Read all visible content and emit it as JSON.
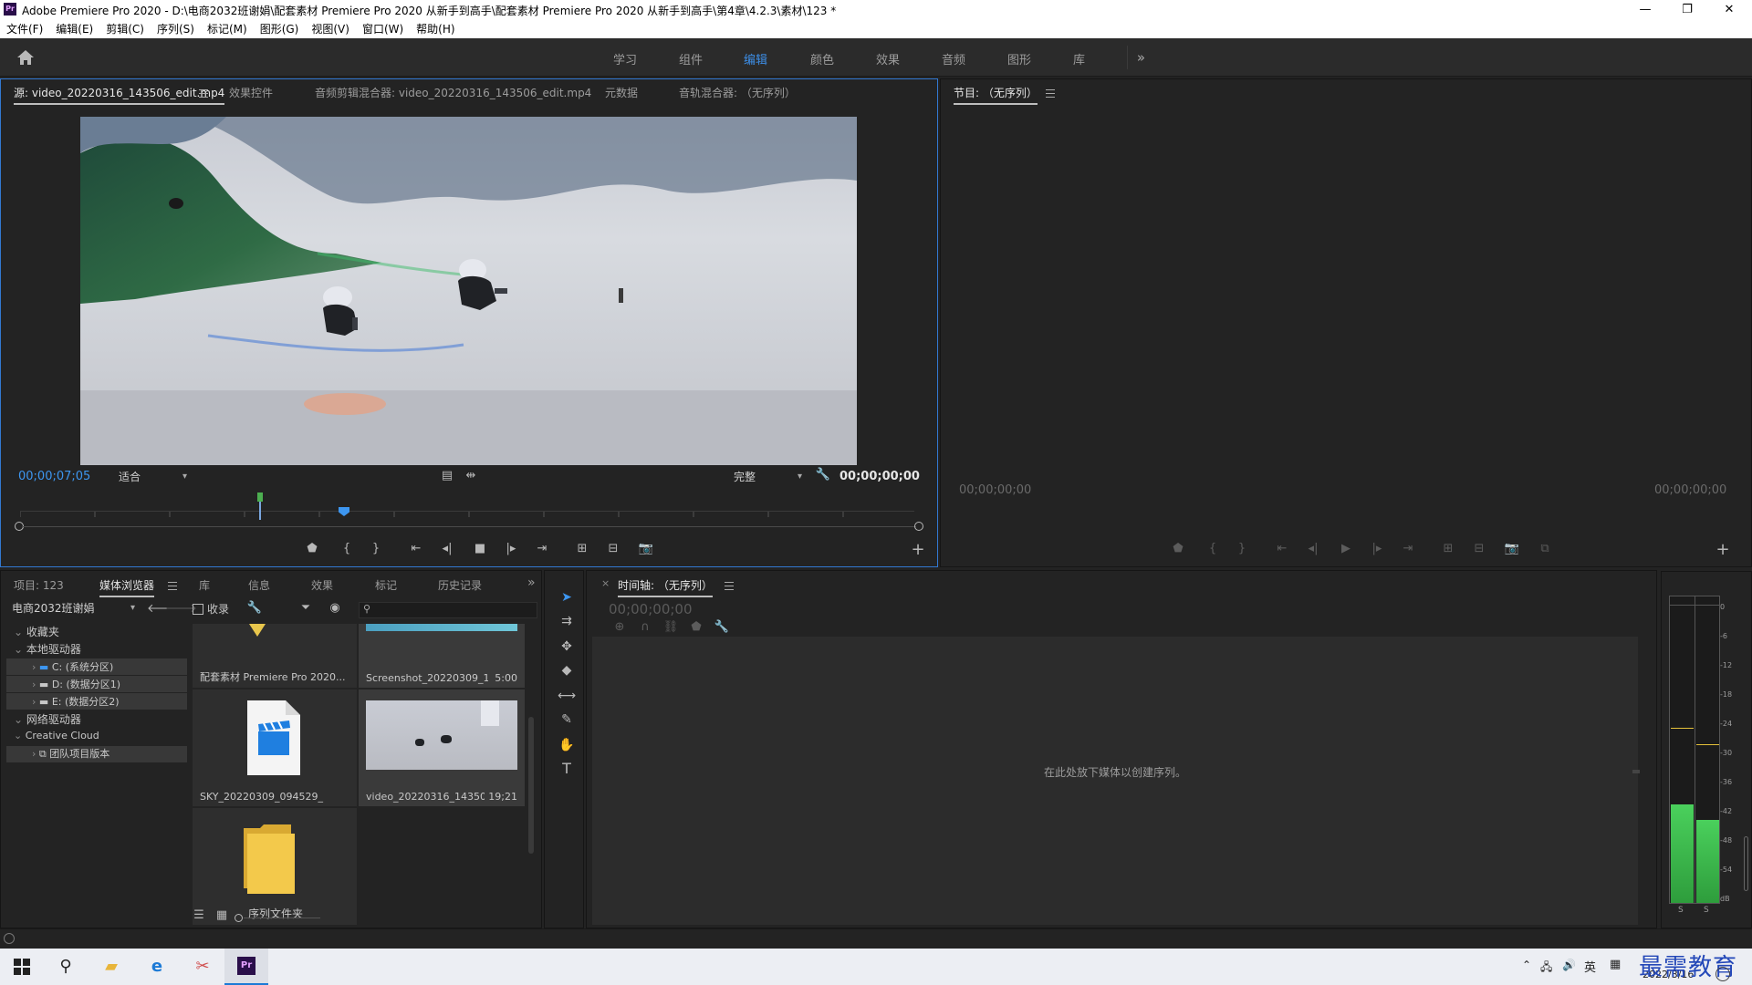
{
  "window": {
    "app_icon_text": "Pr",
    "title": "Adobe Premiere Pro 2020 - D:\\电商2032班谢娟\\配套素材 Premiere Pro 2020 从新手到高手\\配套素材 Premiere Pro 2020 从新手到高手\\第4章\\4.2.3\\素材\\123 *",
    "minimize": "—",
    "restore": "❐",
    "close": "✕"
  },
  "menu": [
    "文件(F)",
    "编辑(E)",
    "剪辑(C)",
    "序列(S)",
    "标记(M)",
    "图形(G)",
    "视图(V)",
    "窗口(W)",
    "帮助(H)"
  ],
  "workspaces": {
    "items": [
      "学习",
      "组件",
      "编辑",
      "颜色",
      "效果",
      "音频",
      "图形",
      "库"
    ],
    "active": "编辑",
    "overflow": "»"
  },
  "source_panel": {
    "tabs": [
      "源: video_20220316_143506_edit.mp4",
      "效果控件",
      "音频剪辑混合器: video_20220316_143506_edit.mp4",
      "元数据",
      "音轨混合器: （无序列）"
    ],
    "playhead_timecode": "00;00;07;05",
    "zoom": "适合",
    "quality": "完整",
    "duration_timecode": "00;00;00;00",
    "plus": "+"
  },
  "program_panel": {
    "title": "节目: （无序列）",
    "timecode_left": "00;00;00;00",
    "timecode_right": "00;00;00;00",
    "plus": "+"
  },
  "project_panel": {
    "tabs": [
      "项目: 123",
      "媒体浏览器",
      "库",
      "信息",
      "效果",
      "标记",
      "历史记录"
    ],
    "active_tab": "媒体浏览器",
    "overflow": "»",
    "location": "电商2032班谢娟",
    "ingest_label": "收录",
    "search_placeholder": "",
    "tree": {
      "favorites": "收藏夹",
      "local_drives": "本地驱动器",
      "drive_c": "C: (系统分区)",
      "drive_d": "D: (数据分区1)",
      "drive_e": "E: (数据分区2)",
      "network_drives": "网络驱动器",
      "creative_cloud": "Creative Cloud",
      "team_projects": "团队项目版本"
    },
    "items": [
      {
        "label": "配套素材 Premiere Pro 2020...",
        "duration": ""
      },
      {
        "label": "Screenshot_20220309_14...",
        "duration": "5:00"
      },
      {
        "label": "SKY_20220309_094529_",
        "duration": ""
      },
      {
        "label": "video_20220316_14350...",
        "duration": "19;21"
      },
      {
        "label": "序列文件夹",
        "duration": ""
      }
    ]
  },
  "timeline_panel": {
    "title": "时间轴: （无序列）",
    "timecode": "00;00;00;00",
    "empty_message": "在此处放下媒体以创建序列。"
  },
  "meters": {
    "scale": [
      "0",
      "-6",
      "-12",
      "-18",
      "-24",
      "-30",
      "-36",
      "-42",
      "-48",
      "-54",
      "dB"
    ],
    "solo_left": "S",
    "solo_right": "S",
    "level_left": 0.32,
    "level_right": 0.27
  },
  "taskbar": {
    "tray_text": "英",
    "date": "2022/3/16",
    "watermark": "最需教育"
  },
  "colors": {
    "accent": "#3d8ee6",
    "timecode_blue": "#3d96f0",
    "panel_bg": "#232323",
    "focus_border": "#3278d1",
    "meter_green": "#3cb449"
  }
}
